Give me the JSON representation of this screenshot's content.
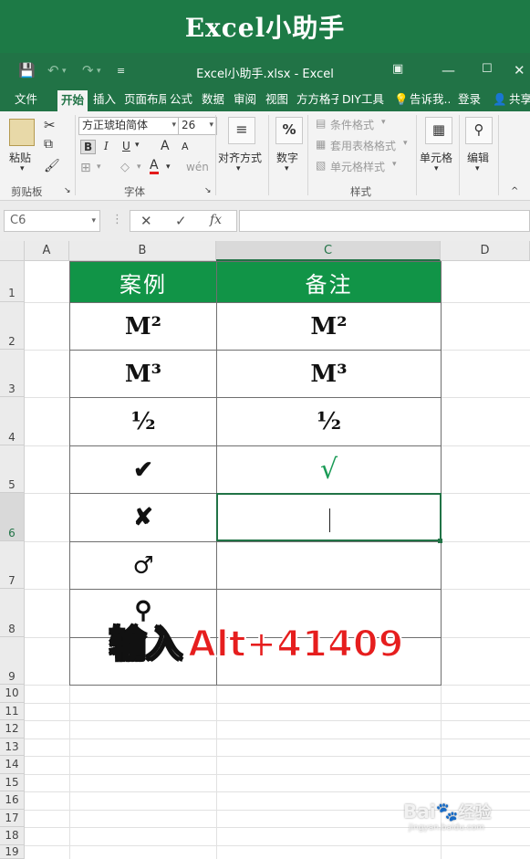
{
  "banner": {
    "title": "Excel小助手"
  },
  "window": {
    "title": "Excel小助手.xlsx - Excel"
  },
  "tabs": [
    "文件",
    "开始",
    "插入",
    "页面布局",
    "公式",
    "数据",
    "审阅",
    "视图",
    "方方格子",
    "DIY工具",
    "告诉我...",
    "登录",
    "共享"
  ],
  "ribbon": {
    "paste_label": "粘贴",
    "font_name": "方正琥珀简体",
    "font_size": "26",
    "bold": "B",
    "italic": "I",
    "underline": "U",
    "grow_font": "A",
    "shrink_font": "A",
    "font_color_glyph": "A",
    "align_label": "对齐方式",
    "percent_glyph": "%",
    "number_label": "数字",
    "conditional_format": "条件格式",
    "table_format": "套用表格格式",
    "cell_styles": "单元格样式",
    "cells_label": "单元格",
    "edit_label": "编辑",
    "groups": {
      "clipboard": "剪贴板",
      "font": "字体",
      "styles": "样式"
    }
  },
  "formula_bar": {
    "name_box": "C6",
    "fx": "fx",
    "cancel": "✕",
    "enter": "✓"
  },
  "sheet": {
    "columns": [
      "A",
      "B",
      "C",
      "D"
    ],
    "rows": [
      "1",
      "2",
      "3",
      "4",
      "5",
      "6",
      "7",
      "8",
      "9",
      "10",
      "11",
      "12",
      "13",
      "14",
      "15",
      "16",
      "17",
      "18",
      "19"
    ],
    "header": {
      "b": "案例",
      "c": "备注"
    },
    "examples": [
      "M²",
      "M³",
      "½",
      "✔",
      "✘",
      "♂",
      "⚲",
      ""
    ],
    "notes": [
      "M²",
      "M³",
      "½",
      "√",
      "",
      "",
      "",
      ""
    ],
    "selected_cell": "C6"
  },
  "overlay": {
    "prefix": "输入",
    "keys": "Alt+41409"
  },
  "watermark": {
    "logo": "Bai",
    "brand": "经验",
    "url": "jingyan.baidu.com"
  }
}
